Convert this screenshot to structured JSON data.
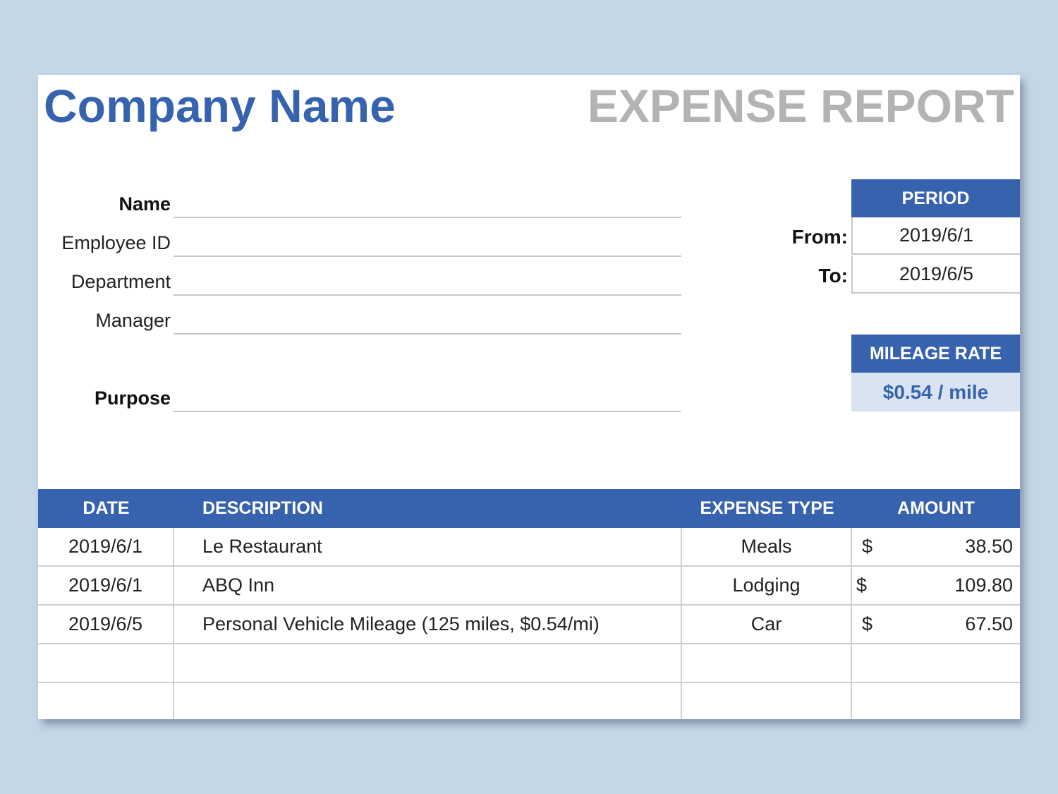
{
  "header": {
    "company_name": "Company Name",
    "report_title": "EXPENSE REPORT"
  },
  "fields": {
    "name_label": "Name",
    "employee_id_label": "Employee ID",
    "department_label": "Department",
    "manager_label": "Manager",
    "purpose_label": "Purpose"
  },
  "period": {
    "header": "PERIOD",
    "from_label": "From:",
    "from_value": "2019/6/1",
    "to_label": "To:",
    "to_value": "2019/6/5"
  },
  "mileage": {
    "header": "MILEAGE RATE",
    "value": "$0.54 / mile"
  },
  "table": {
    "columns": {
      "date": "DATE",
      "description": "DESCRIPTION",
      "expense_type": "EXPENSE TYPE",
      "amount": "AMOUNT"
    },
    "rows": [
      {
        "date": "2019/6/1",
        "description": "Le Restaurant",
        "type": "Meals",
        "currency": "$",
        "amount": "38.50"
      },
      {
        "date": "2019/6/1",
        "description": "ABQ Inn",
        "type": "Lodging",
        "currency": "$",
        "amount": "109.80"
      },
      {
        "date": "2019/6/5",
        "description": "Personal Vehicle Mileage (125 miles, $0.54/mi)",
        "type": "Car",
        "currency": "$",
        "amount": "67.50"
      },
      {
        "date": "",
        "description": "",
        "type": "",
        "currency": "",
        "amount": ""
      },
      {
        "date": "",
        "description": "",
        "type": "",
        "currency": "",
        "amount": ""
      }
    ]
  },
  "colors": {
    "accent": "#3763ae",
    "title_gray": "#b3b3b3",
    "rate_fill": "#dae3f1",
    "backdrop": "#c5d6e6"
  }
}
